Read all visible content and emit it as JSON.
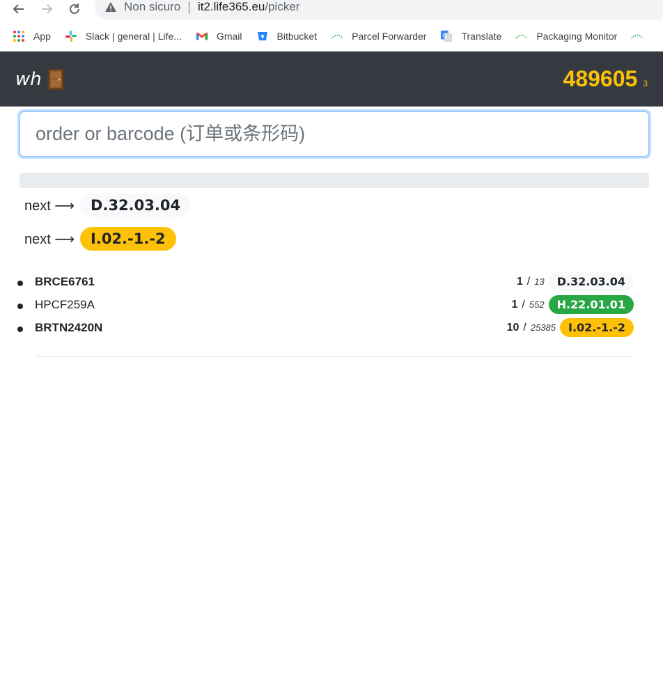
{
  "browser": {
    "insecure_label": "Non sicuro",
    "url_host": "it2.life365.eu",
    "url_path": "/picker",
    "bookmarks": [
      {
        "label": "App",
        "icon": "apps-grid-icon"
      },
      {
        "label": "Slack | general | Life...",
        "icon": "slack-icon"
      },
      {
        "label": "Gmail",
        "icon": "gmail-icon"
      },
      {
        "label": "Bitbucket",
        "icon": "bitbucket-icon"
      },
      {
        "label": "Parcel Forwarder",
        "icon": "dotted-arc-icon"
      },
      {
        "label": "Translate",
        "icon": "translate-icon"
      },
      {
        "label": "Packaging Monitor",
        "icon": "dotted-arc-icon"
      }
    ]
  },
  "header": {
    "brand": "wh",
    "brand_icon": "door-icon",
    "counter": "489605",
    "counter_sub": "3"
  },
  "search": {
    "placeholder": "order or barcode (订单或条形码)",
    "value": ""
  },
  "progress": {
    "fraction": 0
  },
  "next": [
    {
      "label": "next ⟶",
      "location": "D.32.03.04",
      "style": "light"
    },
    {
      "label": "next ⟶",
      "location": "I.02.-1.-2",
      "style": "warning"
    }
  ],
  "items": [
    {
      "code": "BRCE6761",
      "bold": true,
      "count": "1",
      "total": "13",
      "location": "D.32.03.04",
      "style": "light"
    },
    {
      "code": "HPCF259A",
      "bold": false,
      "count": "1",
      "total": "552",
      "location": "H.22.01.01",
      "style": "success"
    },
    {
      "code": "BRTN2420N",
      "bold": true,
      "count": "10",
      "total": "25385",
      "location": "I.02.-1.-2",
      "style": "warning"
    }
  ],
  "colors": {
    "header_bg": "#343a40",
    "accent": "#ffc107",
    "success": "#28a745",
    "light": "#f8f9fa"
  }
}
